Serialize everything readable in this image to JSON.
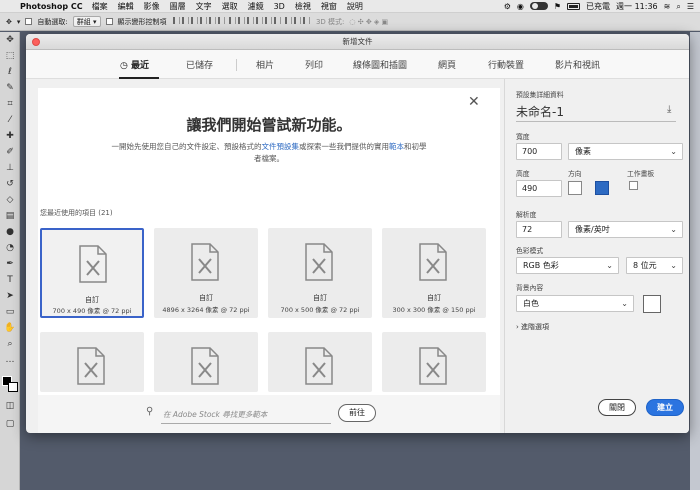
{
  "menubar": {
    "app_name": "Photoshop CC",
    "items": [
      "檔案",
      "編輯",
      "影像",
      "圖層",
      "文字",
      "選取",
      "濾鏡",
      "3D",
      "檢視",
      "視窗",
      "說明"
    ],
    "battery_text": "已充電",
    "clock": "週一 11:36"
  },
  "optionsbar": {
    "auto_select_label": "自動選取:",
    "auto_select_value": "群組",
    "transform_label": "顯示變形控制項",
    "mode_3d_label": "3D 模式:"
  },
  "dialog": {
    "title": "新增文件",
    "tabs": [
      "最近",
      "已儲存",
      "相片",
      "列印",
      "線條圖和插圖",
      "網頁",
      "行動裝置",
      "影片和視訊"
    ],
    "active_tab": 0,
    "welcome": {
      "title": "讓我們開始嘗試新功能。",
      "sub_1": "一開始先使用您自己的文件設定、預設格式的",
      "sub_link1": "文件預設集",
      "sub_2": "或探索一些我們提供的實用",
      "sub_link2": "範本",
      "sub_3": "和初學者檔案。"
    },
    "recent_heading": "您最近使用的項目 (21)",
    "recent_items": [
      {
        "name": "自訂",
        "size": "700 x 490 像素 @ 72 ppi"
      },
      {
        "name": "自訂",
        "size": "4896 x 3264 像素 @ 72 ppi"
      },
      {
        "name": "自訂",
        "size": "700 x 500 像素 @ 72 ppi"
      },
      {
        "name": "自訂",
        "size": "300 x 300 像素 @ 150 ppi"
      }
    ],
    "stock_search": {
      "placeholder": "在 Adobe Stock 尋找更多範本",
      "go_label": "前往"
    },
    "preset": {
      "heading": "預設集詳細資料",
      "doc_name": "未命名-1",
      "width_label": "寬度",
      "width_value": "700",
      "width_unit": "像素",
      "height_label": "高度",
      "height_value": "490",
      "orientation_label": "方向",
      "artboards_label": "工作畫板",
      "resolution_label": "解析度",
      "resolution_value": "72",
      "resolution_unit": "像素/英吋",
      "color_mode_label": "色彩模式",
      "color_mode_value": "RGB 色彩",
      "bit_depth_value": "8 位元",
      "bg_label": "背景內容",
      "bg_value": "白色",
      "advanced_label": "進階選項"
    },
    "buttons": {
      "close": "關閉",
      "create": "建立"
    }
  },
  "colors": {
    "accent": "#2b74e0",
    "selected_tile_border": "#3a63c9",
    "workspace_bg": "#535b6b"
  }
}
